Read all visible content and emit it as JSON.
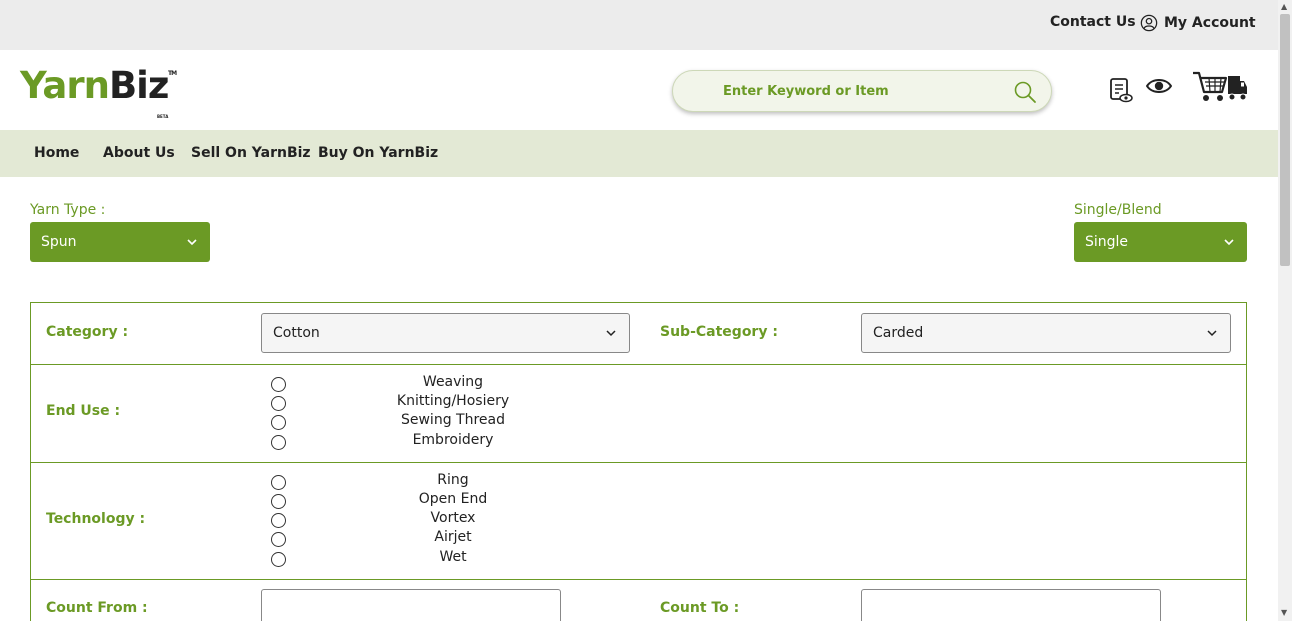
{
  "topbar": {
    "contact": "Contact Us",
    "account": "My Account"
  },
  "logo": {
    "yarn": "Yarn",
    "biz": "Biz",
    "tm": "TM",
    "beta": "BETA"
  },
  "search": {
    "placeholder": "Enter Keyword or Item"
  },
  "header_icons": [
    "enquiry-icon",
    "eye-icon",
    "cart-truck-icon"
  ],
  "nav": {
    "items": [
      "Home",
      "About Us",
      "Sell On YarnBiz",
      "Buy On YarnBiz"
    ]
  },
  "filters": {
    "yarn_type_label": "Yarn Type :",
    "yarn_type_value": "Spun",
    "single_blend_label": "Single/Blend",
    "single_blend_value": "Single"
  },
  "form": {
    "category_label": "Category :",
    "category_value": "Cotton",
    "subcategory_label": "Sub-Category :",
    "subcategory_value": "Carded",
    "end_use_label": "End Use :",
    "end_use_options": [
      "Weaving",
      "Knitting/Hosiery",
      "Sewing Thread",
      "Embroidery"
    ],
    "technology_label": "Technology :",
    "technology_options": [
      "Ring",
      "Open End",
      "Vortex",
      "Airjet",
      "Wet"
    ],
    "count_from_label": "Count From :",
    "count_to_label": "Count To :"
  },
  "colors": {
    "brand_green": "#6b9a25",
    "nav_bg": "#e3e9d5",
    "topbar_bg": "#ececec"
  }
}
